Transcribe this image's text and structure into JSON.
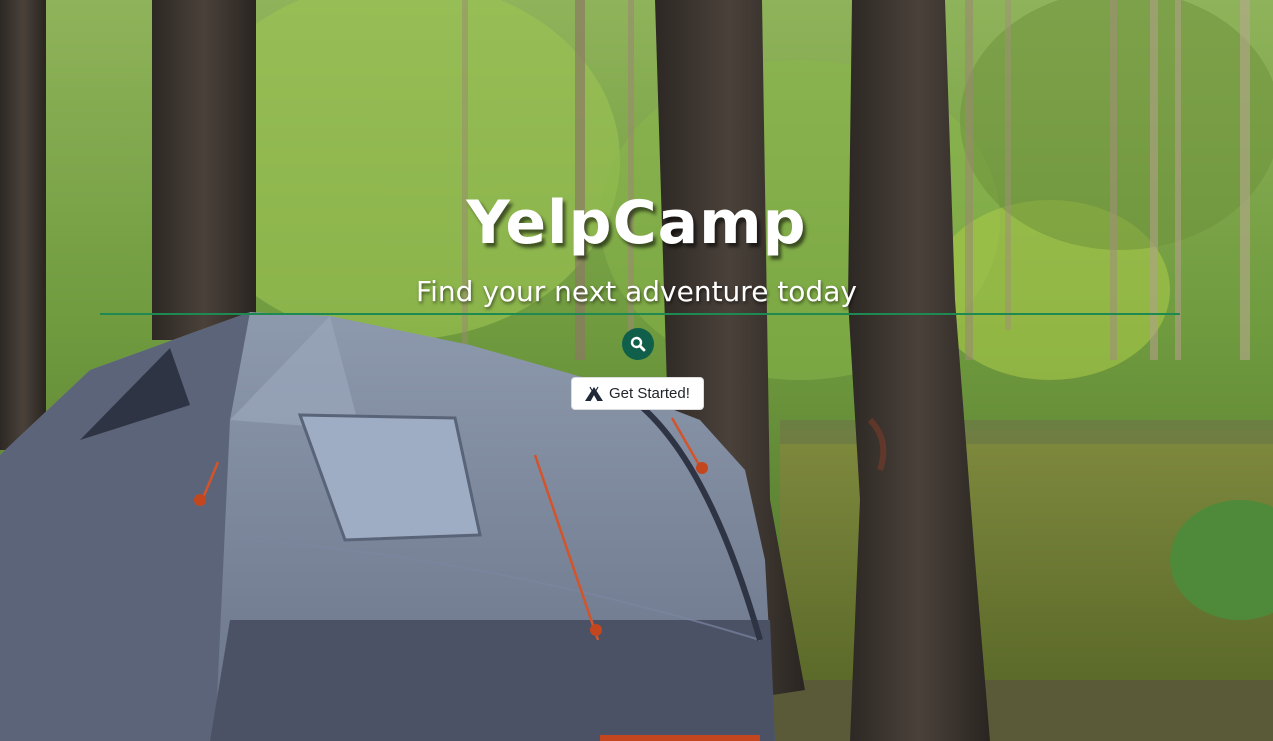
{
  "hero": {
    "title": "YelpCamp",
    "subtitle": "Find your next adventure today",
    "background_description_icon": "forest-tent-photo",
    "divider_color": "#1e8a52"
  },
  "search": {
    "icon": "search-icon",
    "background_color": "#0f5f4a"
  },
  "cta": {
    "icon": "campground-icon",
    "label": "Get Started!"
  }
}
